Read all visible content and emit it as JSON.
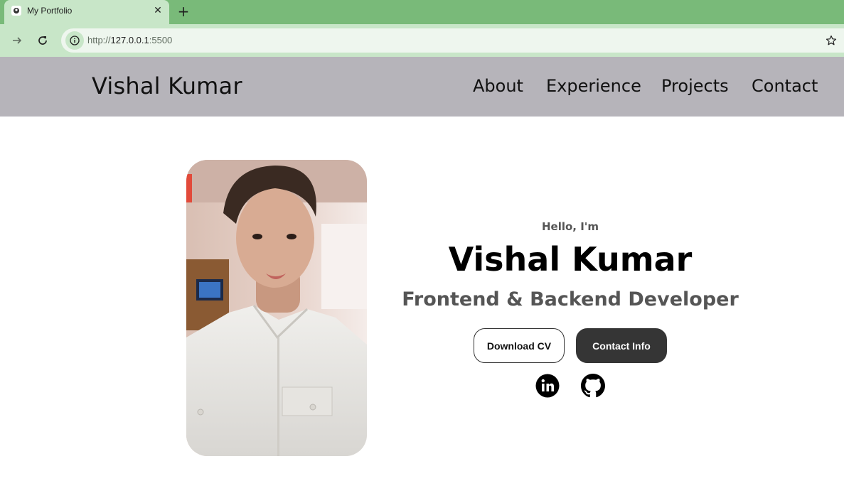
{
  "browser": {
    "tab_title": "My Portfolio",
    "tab_close": "✕",
    "new_tab": "+",
    "url_prefix": "http://",
    "url_host": "127.0.0.1",
    "url_port": ":5500"
  },
  "nav": {
    "logo": "Vishal Kumar",
    "links": [
      "About",
      "Experience",
      "Projects",
      "Contact"
    ]
  },
  "hero": {
    "greeting": "Hello, I'm",
    "name": "Vishal Kumar",
    "role": "Frontend & Backend Developer",
    "buttons": {
      "download": "Download CV",
      "contact": "Contact Info"
    },
    "socials": [
      "linkedin-icon",
      "github-icon"
    ]
  },
  "colors": {
    "tab_strip": "#79ba79",
    "toolbar": "#c8e6c8",
    "site_nav": "#b6b4ba",
    "dark_button": "#353535"
  }
}
